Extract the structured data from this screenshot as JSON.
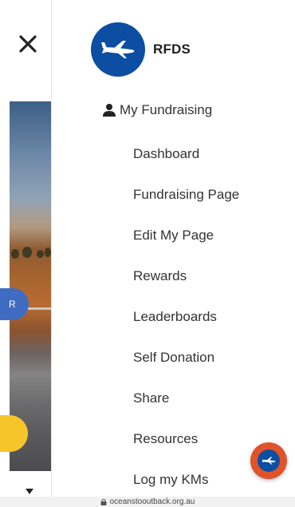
{
  "brand": {
    "name": "RFDS",
    "logo_icon": "rfds-plane-logo-icon",
    "logo_color": "#0b4ea2"
  },
  "menu": {
    "section_label": "My Fundraising",
    "section_icon": "user-icon",
    "items": [
      {
        "label": "Dashboard"
      },
      {
        "label": "Fundraising Page"
      },
      {
        "label": "Edit My Page"
      },
      {
        "label": "Rewards"
      },
      {
        "label": "Leaderboards"
      },
      {
        "label": "Self Donation"
      },
      {
        "label": "Share"
      },
      {
        "label": "Resources"
      },
      {
        "label": "Log my KMs"
      }
    ]
  },
  "backdrop": {
    "close_icon": "close-icon",
    "chip_text": "R",
    "chip_color": "#3f6cc0",
    "button_color": "#f5c52a"
  },
  "fab": {
    "icon": "rfds-plane-icon",
    "color": "#e0522a"
  },
  "browser": {
    "url": "oceanstooutback.org.au",
    "lock_icon": "lock-icon"
  }
}
